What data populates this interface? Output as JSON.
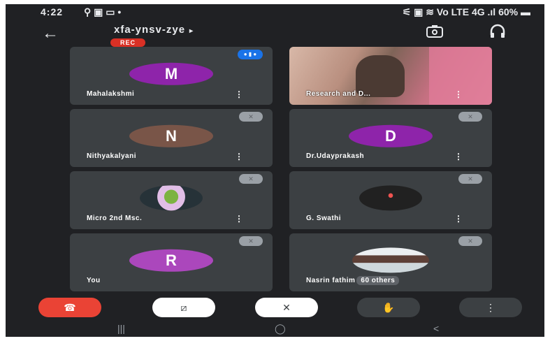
{
  "status_bar": {
    "time": "4:22",
    "left_icons": "⚲ ▣ ▭ •",
    "right_icons": "⚟ ▣ ≋ Vo LTE 4G .ıl",
    "battery": "60%"
  },
  "header": {
    "meeting_code": "xfa-ynsv-zye",
    "meeting_code_arrow": "▸",
    "rec_label": "REC",
    "back_icon": "arrow-left-icon",
    "switch_camera_icon": "switch-camera-icon",
    "audio_icon": "headphones-icon"
  },
  "participants": [
    {
      "name": "Mahalakshmi",
      "initial": "M",
      "avatar_color": "#8e24aa",
      "state": "speaking"
    },
    {
      "name": "Research and D...",
      "initial": "",
      "avatar_color": "",
      "state": "video"
    },
    {
      "name": "Nithyakalyani",
      "initial": "N",
      "avatar_color": "#795548",
      "state": "muted"
    },
    {
      "name": "Dr.Udayprakash",
      "initial": "D",
      "avatar_color": "#8e24aa",
      "state": "muted"
    },
    {
      "name": "Micro 2nd Msc.",
      "initial": "",
      "avatar_color": "",
      "state": "muted"
    },
    {
      "name": "G. Swathi",
      "initial": "",
      "avatar_color": "",
      "state": "muted"
    },
    {
      "name": "You",
      "initial": "R",
      "avatar_color": "#ab47bc",
      "state": "muted"
    },
    {
      "name": "Nasrin fathim",
      "others": "60 others",
      "initial": "",
      "avatar_color": "",
      "state": "muted"
    }
  ],
  "controls": {
    "end_call_icon": "phone-hangup-icon",
    "camera_icon": "camera-off-icon",
    "mic_icon": "mic-off-icon",
    "hand_icon": "raise-hand-icon",
    "more_icon": "more-vertical-icon",
    "end_color": "#ea4335"
  },
  "nav": {
    "recents": "|||",
    "home": "◯",
    "back": "<"
  }
}
